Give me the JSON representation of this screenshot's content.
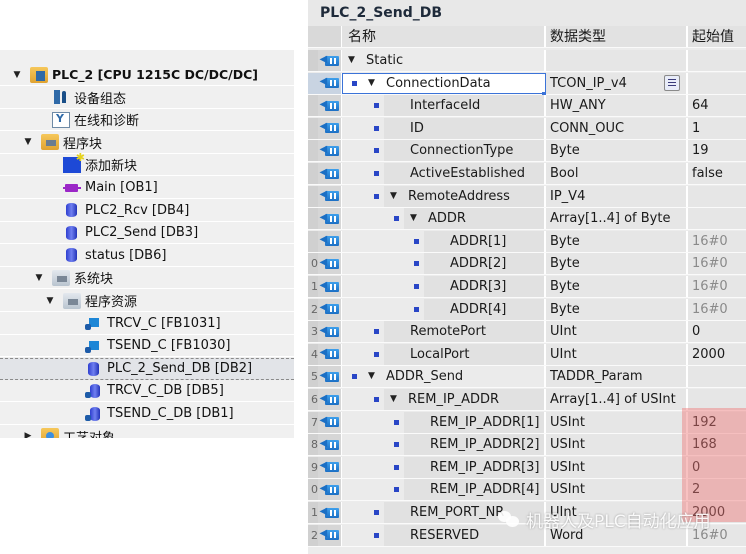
{
  "tree": {
    "items": [
      {
        "label": "PLC_2 [CPU 1215C DC/DC/DC]",
        "icon": "plc-device-icon",
        "expander": "▼",
        "level": 0,
        "bold": true
      },
      {
        "label": "设备组态",
        "icon": "device-config-icon",
        "expander": "",
        "level": 2
      },
      {
        "label": "在线和诊断",
        "icon": "online-diagnostics-icon",
        "expander": "",
        "level": 2
      },
      {
        "label": "程序块",
        "icon": "block-folder-icon",
        "expander": "▼",
        "level": 1
      },
      {
        "label": "添加新块",
        "icon": "add-new-block-icon",
        "expander": "",
        "level": 3
      },
      {
        "label": "Main [OB1]",
        "icon": "ob-block-icon",
        "expander": "",
        "level": 3
      },
      {
        "label": "PLC2_Rcv [DB4]",
        "icon": "db-block-icon",
        "expander": "",
        "level": 3
      },
      {
        "label": "PLC2_Send [DB3]",
        "icon": "db-block-icon",
        "expander": "",
        "level": 3
      },
      {
        "label": "status [DB6]",
        "icon": "db-block-icon",
        "expander": "",
        "level": 3
      },
      {
        "label": "系统块",
        "icon": "system-folder-icon",
        "expander": "▼",
        "level": 2
      },
      {
        "label": "程序资源",
        "icon": "system-folder-icon",
        "expander": "▼",
        "level": 3
      },
      {
        "label": "TRCV_C [FB1031]",
        "icon": "fb-block-icon",
        "expander": "",
        "level": 5
      },
      {
        "label": "TSEND_C [FB1030]",
        "icon": "fb-block-icon",
        "expander": "",
        "level": 5
      },
      {
        "label": "PLC_2_Send_DB [DB2]",
        "icon": "db-block-icon",
        "expander": "",
        "level": 5,
        "selected": true
      },
      {
        "label": "TRCV_C_DB [DB5]",
        "icon": "locked-db-icon",
        "expander": "",
        "level": 5
      },
      {
        "label": "TSEND_C_DB [DB1]",
        "icon": "locked-db-icon",
        "expander": "",
        "level": 5
      },
      {
        "label": "工艺对象",
        "icon": "technology-folder-icon",
        "expander": "▶",
        "level": 1
      }
    ]
  },
  "editor": {
    "title": "PLC_2_Send_DB",
    "columns": {
      "name": "名称",
      "type": "数据类型",
      "start_value": "起始值"
    },
    "rows": [
      {
        "num": "",
        "level": 0,
        "bullet": false,
        "expander": "▼",
        "name": "Static",
        "type": "",
        "value": "",
        "value_gray": false
      },
      {
        "num": "",
        "level": 1,
        "bullet": true,
        "expander": "▼",
        "name": "ConnectionData",
        "type": "TCON_IP_v4",
        "value": "",
        "value_gray": false,
        "active": true,
        "has_struct_button": true
      },
      {
        "num": "",
        "level": 2,
        "bullet": true,
        "expander": "",
        "name": "InterfaceId",
        "type": "HW_ANY",
        "value": "64",
        "value_gray": false
      },
      {
        "num": "",
        "level": 2,
        "bullet": true,
        "expander": "",
        "name": "ID",
        "type": "CONN_OUC",
        "value": "1",
        "value_gray": false
      },
      {
        "num": "",
        "level": 2,
        "bullet": true,
        "expander": "",
        "name": "ConnectionType",
        "type": "Byte",
        "value": "19",
        "value_gray": false
      },
      {
        "num": "",
        "level": 2,
        "bullet": true,
        "expander": "",
        "name": "ActiveEstablished",
        "type": "Bool",
        "value": "false",
        "value_gray": false
      },
      {
        "num": "",
        "level": 2,
        "bullet": true,
        "expander": "▼",
        "name": "RemoteAddress",
        "type": "IP_V4",
        "value": "",
        "value_gray": false
      },
      {
        "num": "",
        "level": 3,
        "bullet": true,
        "expander": "▼",
        "name": "ADDR",
        "type": "Array[1..4] of Byte",
        "value": "",
        "value_gray": false
      },
      {
        "num": "",
        "level": 4,
        "bullet": true,
        "expander": "",
        "name": "ADDR[1]",
        "type": "Byte",
        "value": "16#0",
        "value_gray": true
      },
      {
        "num": "0",
        "level": 4,
        "bullet": true,
        "expander": "",
        "name": "ADDR[2]",
        "type": "Byte",
        "value": "16#0",
        "value_gray": true
      },
      {
        "num": "1",
        "level": 4,
        "bullet": true,
        "expander": "",
        "name": "ADDR[3]",
        "type": "Byte",
        "value": "16#0",
        "value_gray": true
      },
      {
        "num": "2",
        "level": 4,
        "bullet": true,
        "expander": "",
        "name": "ADDR[4]",
        "type": "Byte",
        "value": "16#0",
        "value_gray": true
      },
      {
        "num": "3",
        "level": 2,
        "bullet": true,
        "expander": "",
        "name": "RemotePort",
        "type": "UInt",
        "value": "0",
        "value_gray": false
      },
      {
        "num": "4",
        "level": 2,
        "bullet": true,
        "expander": "",
        "name": "LocalPort",
        "type": "UInt",
        "value": "2000",
        "value_gray": false
      },
      {
        "num": "5",
        "level": 1,
        "bullet": true,
        "expander": "▼",
        "name": "ADDR_Send",
        "type": "TADDR_Param",
        "value": "",
        "value_gray": false
      },
      {
        "num": "6",
        "level": 2,
        "bullet": true,
        "expander": "▼",
        "name": "REM_IP_ADDR",
        "type": "Array[1..4] of USInt",
        "value": "",
        "value_gray": false
      },
      {
        "num": "7",
        "level": 3,
        "bullet": true,
        "expander": "",
        "name": "REM_IP_ADDR[1]",
        "type": "USInt",
        "value": "192",
        "value_gray": false
      },
      {
        "num": "8",
        "level": 3,
        "bullet": true,
        "expander": "",
        "name": "REM_IP_ADDR[2]",
        "type": "USInt",
        "value": "168",
        "value_gray": false
      },
      {
        "num": "9",
        "level": 3,
        "bullet": true,
        "expander": "",
        "name": "REM_IP_ADDR[3]",
        "type": "USInt",
        "value": "0",
        "value_gray": false
      },
      {
        "num": "0",
        "level": 3,
        "bullet": true,
        "expander": "",
        "name": "REM_IP_ADDR[4]",
        "type": "USInt",
        "value": "2",
        "value_gray": false
      },
      {
        "num": "1",
        "level": 2,
        "bullet": true,
        "expander": "",
        "name": "REM_PORT_NR",
        "type": "UInt",
        "value": "2000",
        "value_gray": false
      },
      {
        "num": "2",
        "level": 2,
        "bullet": true,
        "expander": "",
        "name": "RESERVED",
        "type": "Word",
        "value": "16#0",
        "value_gray": true
      }
    ]
  },
  "colors": {
    "highlight": "#f07878",
    "bullet": "#2946c6",
    "selection_outline": "#3b73d8"
  },
  "watermark": {
    "text": "机器人及PLC自动化应用",
    "icon": "wechat-icon"
  }
}
